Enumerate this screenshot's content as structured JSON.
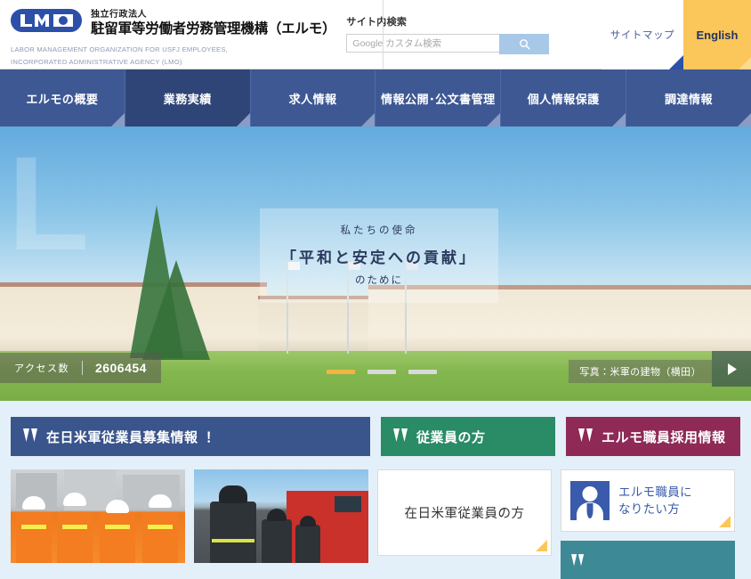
{
  "header": {
    "logo": {
      "mark_text": "LMO",
      "kicker": "独立行政法人",
      "title": "駐留軍等労働者労務管理機構（エルモ）",
      "english_line1": "LABOR MANAGEMENT ORGANIZATION FOR USFJ EMPLOYEES,",
      "english_line2": "INCORPORATED ADMINISTRATIVE AGENCY (LMO)"
    },
    "search": {
      "label": "サイト内検索",
      "placeholder": "Google カスタム検索",
      "value": "",
      "button_icon": "search-icon"
    },
    "sitemap_label": "サイトマップ",
    "english_label": "English"
  },
  "nav": {
    "items": [
      {
        "label": "エルモの概要",
        "active": false
      },
      {
        "label": "業務実績",
        "active": true
      },
      {
        "label": "求人情報",
        "active": false
      },
      {
        "label": "情報公開･公文書管理",
        "active": false
      },
      {
        "label": "個人情報保護",
        "active": false
      },
      {
        "label": "調達情報",
        "active": false
      }
    ]
  },
  "hero": {
    "watermark": "LMO",
    "message": {
      "line1": "私たちの使命",
      "line2": "「平和と安定への貢献」",
      "line3": "のために"
    },
    "access_label": "アクセス数",
    "access_count": "2606454",
    "caption": "写真：米軍の建物（横田）",
    "next_icon": "play-arrow-icon",
    "slides": [
      {
        "active": true
      },
      {
        "active": false
      },
      {
        "active": false
      }
    ]
  },
  "banners": [
    {
      "label": "在日米軍従業員募集情報 ！",
      "color": "#3a548c",
      "icon": "double-chevron-down-icon"
    },
    {
      "label": "従業員の方",
      "color": "#2a8b67",
      "icon": "double-chevron-down-icon"
    },
    {
      "label": "エルモ職員採用情報",
      "color": "#8e2a55",
      "icon": "double-chevron-down-icon"
    }
  ],
  "cards": {
    "photo_workers_alt": "photo-workers-safety-vests",
    "photo_firefighters_alt": "photo-firefighters-engine",
    "link_card_label": "在日米軍従業員の方",
    "staff_card_line1": "エルモ職員に",
    "staff_card_line2": "なりたい方",
    "staff_card_icon": "person-with-tie-icon",
    "teal_card_label": "",
    "corner_accent_color": "#fbc65a"
  }
}
